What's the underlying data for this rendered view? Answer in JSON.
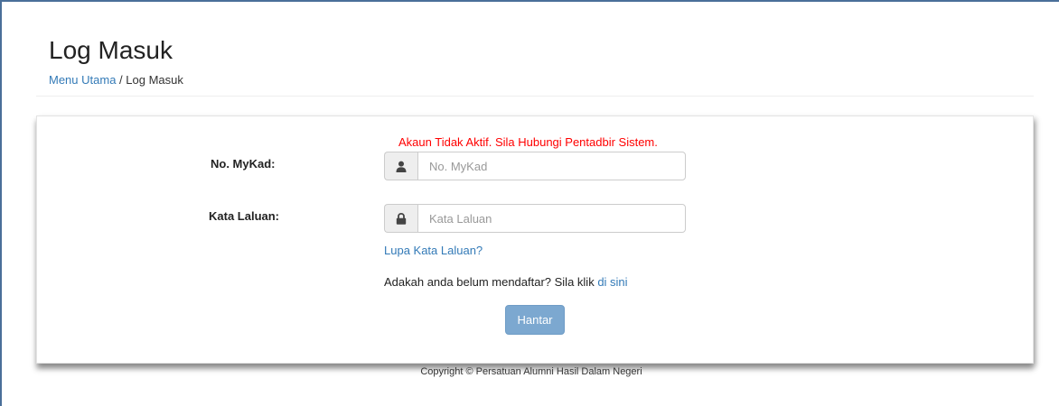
{
  "page": {
    "title": "Log Masuk"
  },
  "breadcrumb": {
    "home_label": "Menu Utama",
    "separator": " / ",
    "current": "Log Masuk"
  },
  "form": {
    "error_message": "Akaun Tidak Aktif. Sila Hubungi Pentadbir Sistem.",
    "mykad": {
      "label": "No. MyKad:",
      "value": "",
      "placeholder": "No. MyKad",
      "icon": "user-icon"
    },
    "password": {
      "label": "Kata Laluan:",
      "value": "",
      "placeholder": "Kata Laluan",
      "icon": "lock-icon"
    },
    "forgot_link": "Lupa Kata Laluan?",
    "register_prompt": "Adakah anda belum mendaftar? Sila klik ",
    "register_link": "di sini",
    "submit_label": "Hantar"
  },
  "footer": {
    "copyright": "Copyright © Persatuan Alumni Hasil Dalam Negeri"
  },
  "colors": {
    "link": "#337ab7",
    "error": "#ff0000",
    "button": "#7ca8d0",
    "window_border": "#4a6f99"
  }
}
